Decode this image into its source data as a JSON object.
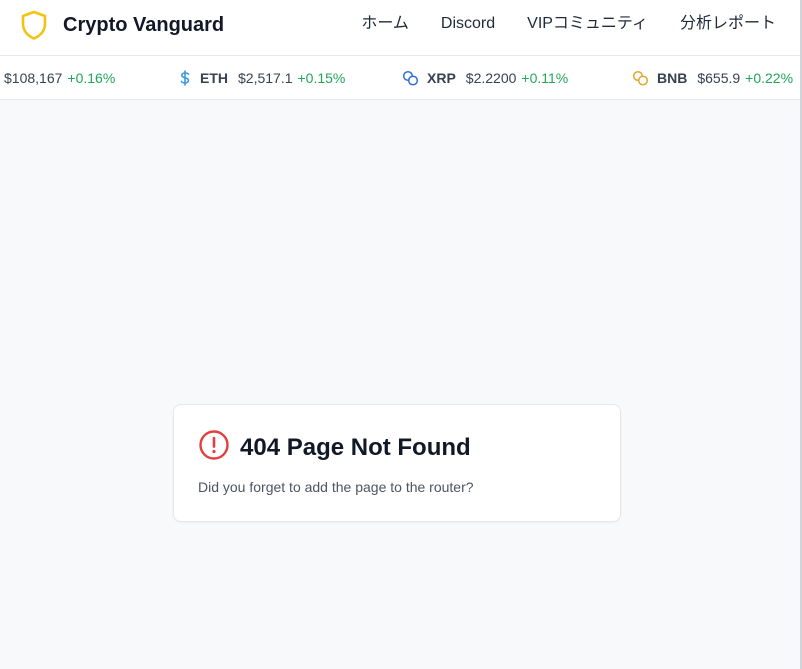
{
  "header": {
    "brand_name": "Crypto Vanguard",
    "nav": [
      "ホーム",
      "Discord",
      "VIPコミュニティ",
      "分析レポート"
    ]
  },
  "ticker": {
    "items": [
      {
        "symbol": "",
        "price": "$108,167",
        "change": "+0.16%",
        "icon": "none"
      },
      {
        "symbol": "ETH",
        "price": "$2,517.1",
        "change": "+0.15%",
        "icon": "dollar-icon"
      },
      {
        "symbol": "XRP",
        "price": "$2.2200",
        "change": "+0.11%",
        "icon": "coins-icon"
      },
      {
        "symbol": "BNB",
        "price": "$655.9",
        "change": "+0.22%",
        "icon": "coins-icon"
      }
    ],
    "colors": {
      "positive": "#22a55a",
      "eth_icon": "#3b9ae1",
      "xrp_icon": "#2f6fdb",
      "bnb_icon": "#e0a92e"
    }
  },
  "error": {
    "title": "404 Page Not Found",
    "message": "Did you forget to add the page to the router?",
    "icon": "alert-circle-icon",
    "icon_color": "#e53e3e"
  },
  "colors": {
    "brand_shield": "#f2c40f",
    "background": "#f8f9fb"
  }
}
